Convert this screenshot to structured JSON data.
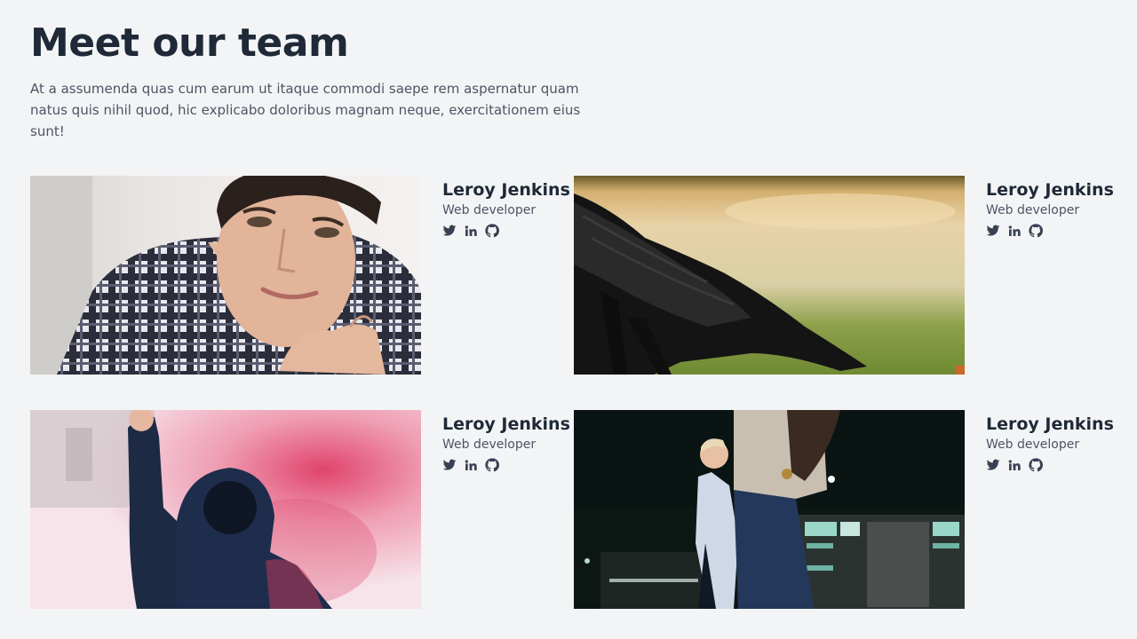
{
  "header": {
    "title": "Meet our team",
    "description": "At a assumenda quas cum earum ut itaque commodi saepe rem aspernatur quam natus quis nihil quod, hic explicabo doloribus magnam neque, exercitationem eius sunt!"
  },
  "team": [
    {
      "name": "Leroy Jenkins",
      "role": "Web developer",
      "photo": "young man in plaid shirt smiling",
      "socials": [
        "twitter-icon",
        "linkedin-icon",
        "github-icon"
      ]
    },
    {
      "name": "Leroy Jenkins",
      "role": "Web developer",
      "photo": "black crow on grass",
      "socials": [
        "twitter-icon",
        "linkedin-icon",
        "github-icon"
      ]
    },
    {
      "name": "Leroy Jenkins",
      "role": "Web developer",
      "photo": "hooded person with pink smoke",
      "socials": [
        "twitter-icon",
        "linkedin-icon",
        "github-icon"
      ]
    },
    {
      "name": "Leroy Jenkins",
      "role": "Web developer",
      "photo": "two men standing at night",
      "socials": [
        "twitter-icon",
        "linkedin-icon",
        "github-icon"
      ]
    }
  ],
  "colors": {
    "background": "#f3f4f6",
    "heading": "#1f2937",
    "body_text": "#4b5563",
    "icon": "#374151"
  }
}
